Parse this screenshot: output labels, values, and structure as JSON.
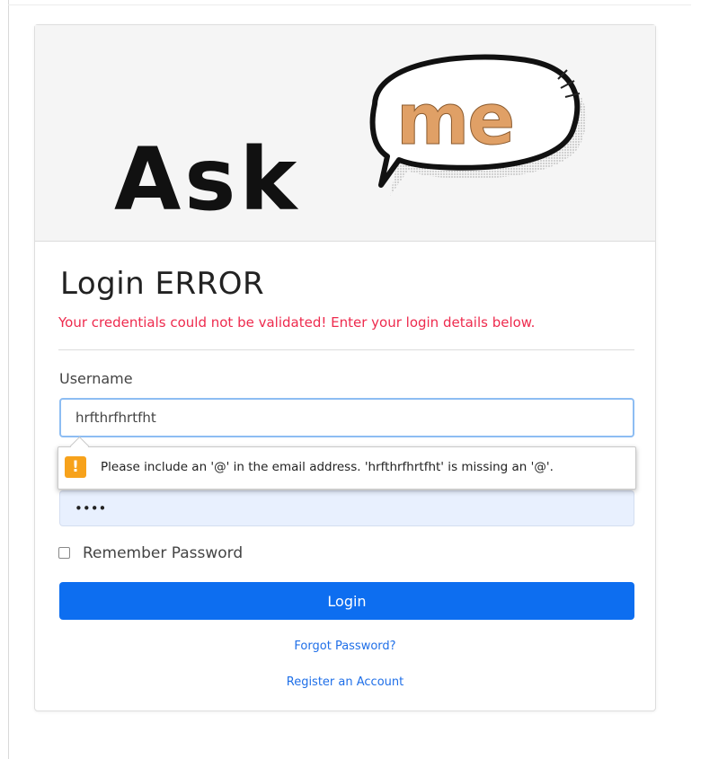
{
  "logo": {
    "text_main": "Ask",
    "text_bubble": "me",
    "accent_color": "#e0a066"
  },
  "login": {
    "title": "Login ERROR",
    "error_message": "Your credentials could not be validated! Enter your login details below.",
    "username_label": "Username",
    "username_value": "hrfthrfhrtfht",
    "password_value": "••••",
    "validation_tooltip": "Please include an '@' in the email address. 'hrfthrfhrtfht' is missing an '@'.",
    "warning_icon": "!",
    "remember_label": "Remember Password",
    "remember_checked": false,
    "login_button": "Login",
    "forgot_link": "Forgot Password?",
    "register_link": "Register an Account"
  },
  "colors": {
    "error": "#ee2b4e",
    "primary": "#0d6ef0",
    "link": "#1f6fe8",
    "warning": "#f7a21b"
  }
}
